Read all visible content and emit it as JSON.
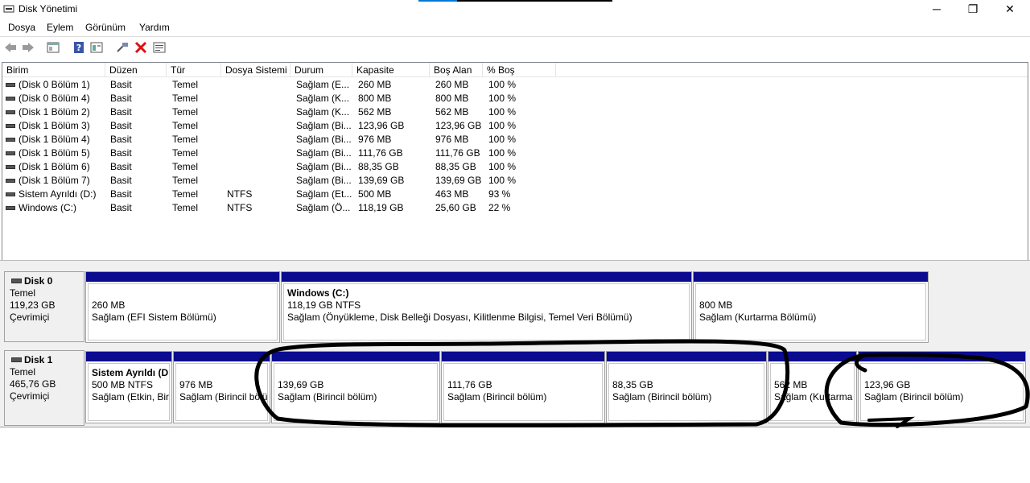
{
  "window": {
    "title": "Disk Yönetimi",
    "minimize": "─",
    "maximize": "❐",
    "close": "✕"
  },
  "menu": [
    "Dosya",
    "Eylem",
    "Görünüm",
    "Yardım"
  ],
  "toolbar": {
    "icons": [
      "back-icon",
      "forward-icon",
      "console-tree-icon",
      "help-icon",
      "properties-icon",
      "connect-icon",
      "delete-icon",
      "settings-icon"
    ]
  },
  "columns": [
    "Birim",
    "Düzen",
    "Tür",
    "Dosya Sistemi",
    "Durum",
    "Kapasite",
    "Boş Alan",
    "% Boş"
  ],
  "volumes": [
    [
      "(Disk 0 Bölüm 1)",
      "Basit",
      "Temel",
      "",
      "Sağlam (E...",
      "260 MB",
      "260 MB",
      "100 %"
    ],
    [
      "(Disk 0 Bölüm 4)",
      "Basit",
      "Temel",
      "",
      "Sağlam (K...",
      "800 MB",
      "800 MB",
      "100 %"
    ],
    [
      "(Disk 1 Bölüm 2)",
      "Basit",
      "Temel",
      "",
      "Sağlam (K...",
      "562 MB",
      "562 MB",
      "100 %"
    ],
    [
      "(Disk 1 Bölüm 3)",
      "Basit",
      "Temel",
      "",
      "Sağlam (Bi...",
      "123,96 GB",
      "123,96 GB",
      "100 %"
    ],
    [
      "(Disk 1 Bölüm 4)",
      "Basit",
      "Temel",
      "",
      "Sağlam (Bi...",
      "976 MB",
      "976 MB",
      "100 %"
    ],
    [
      "(Disk 1 Bölüm 5)",
      "Basit",
      "Temel",
      "",
      "Sağlam (Bi...",
      "111,76 GB",
      "111,76 GB",
      "100 %"
    ],
    [
      "(Disk 1 Bölüm 6)",
      "Basit",
      "Temel",
      "",
      "Sağlam (Bi...",
      "88,35 GB",
      "88,35 GB",
      "100 %"
    ],
    [
      "(Disk 1 Bölüm 7)",
      "Basit",
      "Temel",
      "",
      "Sağlam (Bi...",
      "139,69 GB",
      "139,69 GB",
      "100 %"
    ],
    [
      "Sistem Ayrıldı (D:)",
      "Basit",
      "Temel",
      "NTFS",
      "Sağlam (Et...",
      "500 MB",
      "463 MB",
      "93 %"
    ],
    [
      "Windows (C:)",
      "Basit",
      "Temel",
      "NTFS",
      "Sağlam (Ö...",
      "118,19 GB",
      "25,60 GB",
      "22 %"
    ]
  ],
  "disks": [
    {
      "name": "Disk 0",
      "type": "Temel",
      "size": "119,23 GB",
      "status": "Çevrimiçi",
      "partitions": [
        {
          "name": "",
          "size": "260 MB",
          "status": "Sağlam (EFI Sistem Bölümü)"
        },
        {
          "name": "Windows  (C:)",
          "size": "118,19 GB NTFS",
          "status": "Sağlam (Önyükleme, Disk Belleği Dosyası, Kilitlenme Bilgisi, Temel Veri Bölümü)"
        },
        {
          "name": "",
          "size": "800 MB",
          "status": "Sağlam (Kurtarma Bölümü)"
        }
      ]
    },
    {
      "name": "Disk 1",
      "type": "Temel",
      "size": "465,76 GB",
      "status": "Çevrimiçi",
      "partitions": [
        {
          "name": "Sistem Ayrıldı (D",
          "size": "500 MB NTFS",
          "status": "Sağlam (Etkin, Biri"
        },
        {
          "name": "",
          "size": "976 MB",
          "status": "Sağlam (Birincil bölüm)"
        },
        {
          "name": "",
          "size": "139,69 GB",
          "status": "Sağlam (Birincil bölüm)"
        },
        {
          "name": "",
          "size": "111,76 GB",
          "status": "Sağlam (Birincil bölüm)"
        },
        {
          "name": "",
          "size": "88,35 GB",
          "status": "Sağlam (Birincil bölüm)"
        },
        {
          "name": "",
          "size": "562 MB",
          "status": "Sağlam (Kurtarma"
        },
        {
          "name": "",
          "size": "123,96 GB",
          "status": "Sağlam (Birincil bölüm)"
        }
      ]
    }
  ],
  "colors": {
    "partition_bar": "#0b0b8f",
    "annotation_ink": "#000000"
  }
}
